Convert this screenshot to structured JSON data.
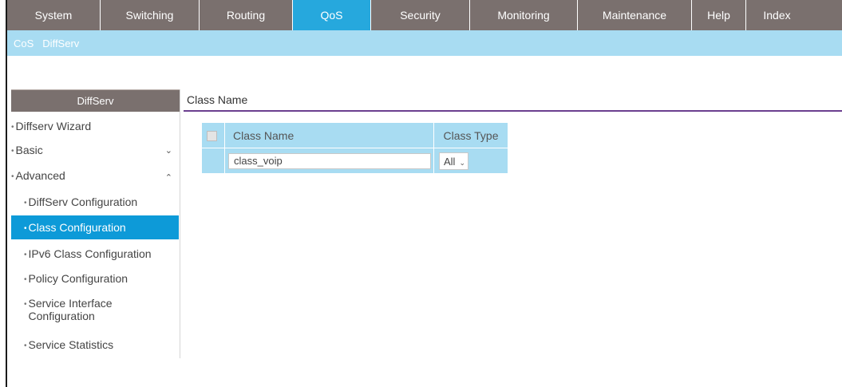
{
  "topnav": {
    "tabs": [
      {
        "label": "System",
        "width": 117
      },
      {
        "label": "Switching",
        "width": 124
      },
      {
        "label": "Routing",
        "width": 117
      },
      {
        "label": "QoS",
        "width": 98
      },
      {
        "label": "Security",
        "width": 124
      },
      {
        "label": "Monitoring",
        "width": 135
      },
      {
        "label": "Maintenance",
        "width": 143
      },
      {
        "label": "Help",
        "width": 68
      },
      {
        "label": "Index",
        "width": 77
      }
    ],
    "active": "QoS"
  },
  "subnav": {
    "items": [
      "CoS",
      "DiffServ"
    ],
    "active": "DiffServ"
  },
  "sidebar": {
    "title": "DiffServ",
    "items": [
      {
        "label": "Diffserv Wizard"
      },
      {
        "label": "Basic"
      },
      {
        "label": "Advanced"
      },
      {
        "label": "DiffServ Configuration"
      },
      {
        "label": "Class Configuration"
      },
      {
        "label": "IPv6 Class Configuration"
      },
      {
        "label": "Policy Configuration"
      },
      {
        "label": "Service Interface Configuration"
      },
      {
        "label": "Service Statistics"
      }
    ],
    "active": "Class Configuration"
  },
  "content": {
    "tab_title": "Class Name",
    "table": {
      "headers": [
        "Class Name",
        "Class Type"
      ],
      "class_name_value": "class_voip",
      "class_type_value": "All"
    }
  }
}
